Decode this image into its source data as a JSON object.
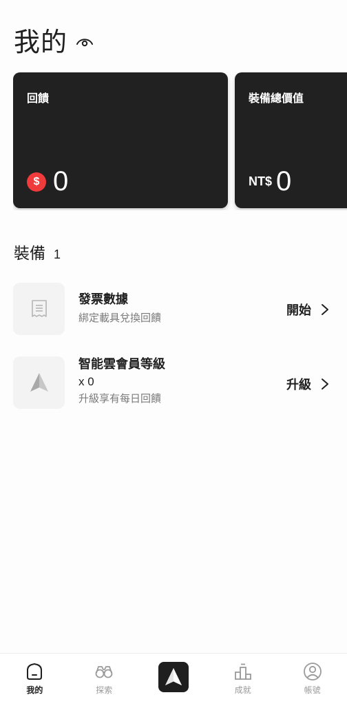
{
  "header": {
    "title": "我的",
    "visibility_icon": "eye-icon"
  },
  "cards": [
    {
      "label": "回饋",
      "icon": "coin-icon",
      "icon_glyph": "$",
      "value": "0"
    },
    {
      "label": "裝備總價值",
      "prefix": "NT$",
      "value": "0"
    }
  ],
  "equipment": {
    "title": "裝備",
    "count": "1",
    "items": [
      {
        "title": "發票數據",
        "subtitle": "綁定載具兌換回饋",
        "action": "開始",
        "icon": "receipt-icon"
      },
      {
        "title": "智能雲會員等級",
        "count": "x 0",
        "subtitle": "升級享有每日回饋",
        "action": "升級",
        "icon": "arrow-logo-icon"
      }
    ]
  },
  "tabbar": {
    "items": [
      {
        "label": "我的",
        "icon": "home-icon",
        "active": true
      },
      {
        "label": "探索",
        "icon": "binoculars-icon",
        "active": false
      },
      {
        "label": "",
        "icon": "arrow-logo-icon",
        "active": false
      },
      {
        "label": "成就",
        "icon": "podium-icon",
        "active": false
      },
      {
        "label": "帳號",
        "icon": "user-icon",
        "active": false
      }
    ]
  },
  "colors": {
    "accent": "#ef3b3b",
    "card_bg": "#212121",
    "text": "#1f1f1f",
    "muted": "#7a7a7a"
  }
}
